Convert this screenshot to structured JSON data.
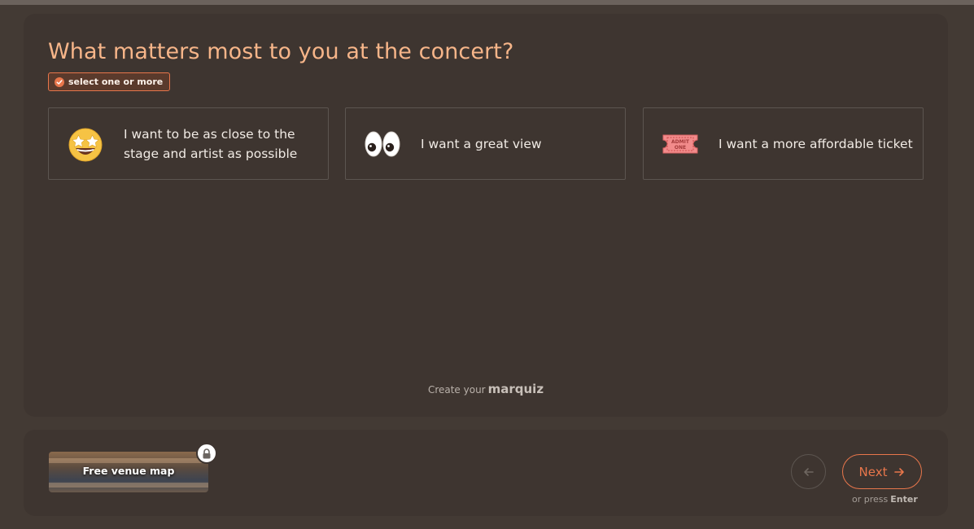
{
  "question": {
    "title": "What matters most to you at the concert?",
    "hint": "select one or more"
  },
  "options": [
    {
      "label": "I want to be as close to the stage and artist as possible",
      "icon": "star-struck-emoji-icon"
    },
    {
      "label": "I want a great view",
      "icon": "eyes-emoji-icon"
    },
    {
      "label": "I want a more affordable ticket",
      "icon": "admission-ticket-emoji-icon",
      "ticket_text_1": "ADMIT",
      "ticket_text_2": "ONE"
    }
  ],
  "branding": {
    "prefix": "Create your",
    "name": "marquiz"
  },
  "bonus": {
    "label": "Free venue map",
    "icon": "lock-icon"
  },
  "navigation": {
    "back_icon": "arrow-left-icon",
    "next_label": "Next",
    "next_icon": "arrow-right-icon",
    "hint_prefix": "or press",
    "hint_key": "Enter"
  },
  "colors": {
    "background": "#433a34",
    "panel": "#3e3530",
    "accent": "#e8764b",
    "title": "#f6b589"
  }
}
